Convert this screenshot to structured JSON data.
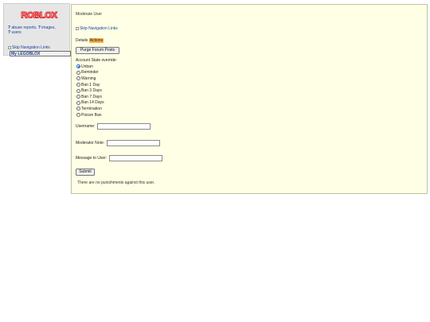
{
  "sidebar": {
    "logo_text": "ROBLOX",
    "links": {
      "q1": "?",
      "abuse_reports": "abuse reports",
      "sep1": ",",
      "q2": "?",
      "images": "images",
      "sep2": ",",
      "q3": "?",
      "users": "users"
    },
    "skip_nav": "Skip Navigation Links",
    "my_legoblox": "My LEGOBLOX"
  },
  "main": {
    "title": "Moderate User",
    "skip_nav": "Skip Navigation Links",
    "tabs": {
      "details": "Details",
      "actions": "Actions"
    },
    "purge_button": "Purge Forum Posts",
    "state_label": "Account State override:",
    "states": [
      {
        "label": "Unban",
        "checked": true
      },
      {
        "label": "Reminder",
        "checked": false
      },
      {
        "label": "Warning",
        "checked": false
      },
      {
        "label": "Ban 1 Day",
        "checked": false
      },
      {
        "label": "Ban 3 Days",
        "checked": false
      },
      {
        "label": "Ban 7 Days",
        "checked": false
      },
      {
        "label": "Ban 14 Days",
        "checked": false
      },
      {
        "label": "Termination",
        "checked": false
      },
      {
        "label": "Poison Ban",
        "checked": false
      }
    ],
    "username_label": "Username:",
    "username_value": "",
    "modnote_label": "Moderator Note:",
    "modnote_value": "",
    "message_label": "Message to User:",
    "message_value": "",
    "submit_button": "Submit",
    "no_punishments": "There are no punishments against this user."
  },
  "colors": {
    "panel_bg": "#ffffe6",
    "sidebar_bg": "#e6e6e6",
    "active_tab": "#ffb14d",
    "link": "#1a3f9c",
    "logo_red": "#e0262b"
  }
}
